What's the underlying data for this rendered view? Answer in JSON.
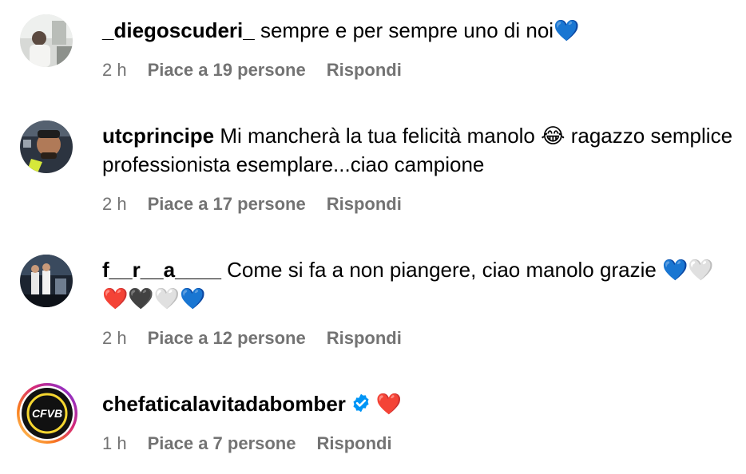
{
  "comments": [
    {
      "username": "_diegoscuderi_",
      "text": "sempre e per sempre uno di noi💙",
      "time": "2 h",
      "likes": "Piace a 19 persone",
      "reply": "Rispondi",
      "avatar_icon": "photo-avatar"
    },
    {
      "username": "utcprincipe",
      "text": "Mi mancherà la tua felicità manolo 😂 ragazzo semplice professionista esemplare...ciao campione",
      "time": "2 h",
      "likes": "Piace a 17 persone",
      "reply": "Rispondi",
      "avatar_icon": "photo-avatar"
    },
    {
      "username": "f__r__a____",
      "text": "Come si fa a non piangere, ciao manolo grazie 💙🤍❤️🖤🤍💙",
      "time": "2 h",
      "likes": "Piace a 12 persone",
      "reply": "Rispondi",
      "avatar_icon": "photo-avatar"
    },
    {
      "username": "chefaticalavitadabomber",
      "text": "❤️",
      "time": "1 h",
      "likes": "Piace a 7 persone",
      "reply": "Rispondi",
      "avatar_icon": "story-ring-logo-avatar",
      "avatar_logo_text": "CFVB",
      "verified": true
    }
  ],
  "colors": {
    "meta": "#737373",
    "verified_blue": "#0095F6",
    "story_ring": [
      "#feda75",
      "#fa7e1e",
      "#d62976",
      "#962fbf",
      "#4f5bd5"
    ]
  }
}
